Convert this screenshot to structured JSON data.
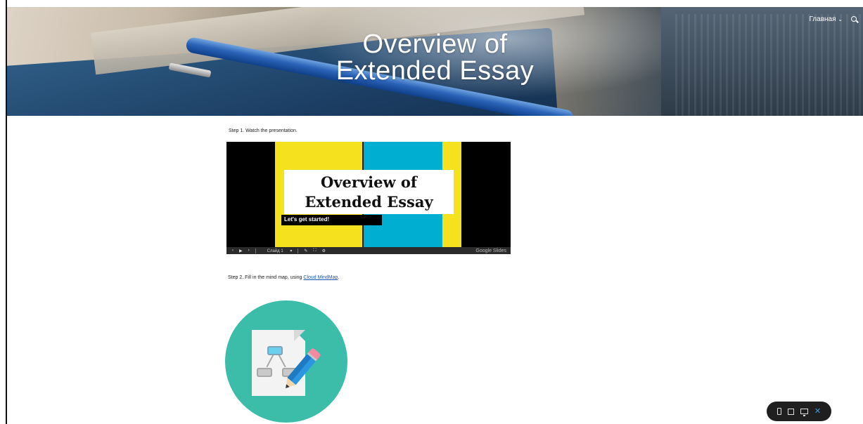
{
  "header": {
    "title_line1": "Overview of",
    "title_line2": "Extended Essay",
    "nav_home": "Главная",
    "nav_chevron": "⌄"
  },
  "steps": {
    "step1": "Step 1. Watch the presentation.",
    "step2_prefix": "Step 2. Fill in the mind map, using ",
    "step2_link": "Cloud MindMap",
    "step2_suffix": "."
  },
  "slides": {
    "title_line1": "Overview of",
    "title_line2": "Extended Essay",
    "subtitle": "Let's get started!",
    "slide_select": "Слайд 1",
    "brand": "Google Slides",
    "prev": "‹",
    "play": "▶",
    "next": "›"
  },
  "colors": {
    "slide_yellow": "#f6e11e",
    "slide_cyan": "#00aed1",
    "mindmap_teal": "#3bbda9",
    "link": "#1a56b8"
  },
  "icons": {
    "search": "search-icon",
    "mindmap": "mindmap-document-icon",
    "phone": "phone-icon",
    "tablet": "tablet-icon",
    "desktop": "desktop-icon",
    "close": "close-icon"
  },
  "device_toggle": {
    "close": "✕"
  }
}
